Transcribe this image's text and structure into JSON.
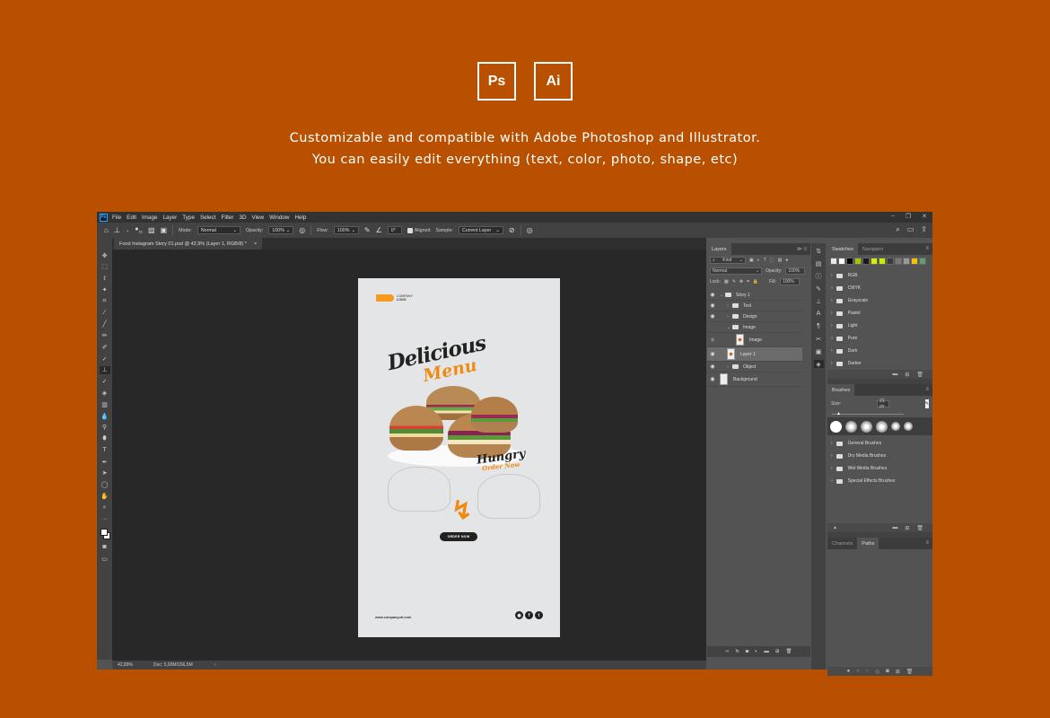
{
  "header": {
    "badges": [
      "Ps",
      "Ai"
    ],
    "tagline_line1": "Customizable and compatible with Adobe Photoshop and Illustrator.",
    "tagline_line2": "You can easily edit everything (text, color, photo, shape, etc)"
  },
  "app": {
    "logo": "Ps",
    "menu": [
      "File",
      "Edit",
      "Image",
      "Layer",
      "Type",
      "Select",
      "Filter",
      "3D",
      "View",
      "Window",
      "Help"
    ],
    "window_controls": [
      "minimize-icon",
      "restore-icon",
      "close-icon"
    ]
  },
  "options": {
    "brush_size": "21",
    "mode_label": "Mode:",
    "mode_value": "Normal",
    "opacity_label": "Opacity:",
    "opacity_value": "100%",
    "flow_label": "Flow:",
    "flow_value": "100%",
    "angle_value": "0°",
    "aligned_label": "Aligned",
    "aligned_checked": true,
    "sample_label": "Sample:",
    "sample_value": "Current Layer"
  },
  "document": {
    "tab_title": "Food Instagram Story 01.psd @ 42,9% (Layer 1, RGB/8) *",
    "tab_close": "×"
  },
  "artwork": {
    "company_line1": "COMPANY",
    "company_line2": "LOGO",
    "title": "Delicious",
    "subtitle": "Menu",
    "hungry_text": "Hungry",
    "order_script": "Order Now",
    "order_button": "ORDER NOW",
    "url": "www.companyurl.com",
    "socials": [
      "instagram-icon",
      "facebook-icon",
      "twitter-icon"
    ],
    "accent_color": "#f08a12"
  },
  "status": {
    "zoom": "42,89%",
    "doc_size": "Doc: 5,93M/156,5M"
  },
  "layers_panel": {
    "tab": "Layers",
    "kind_label": "Kind",
    "blend_mode": "Normal",
    "opacity_label": "Opacity:",
    "opacity_value": "100%",
    "lock_label": "Lock:",
    "fill_label": "Fill:",
    "fill_value": "100%",
    "layers": [
      {
        "name": "Story 1",
        "type": "group",
        "visible": true,
        "expanded": true,
        "indent": 0
      },
      {
        "name": "Text",
        "type": "group",
        "visible": true,
        "expanded": false,
        "indent": 1
      },
      {
        "name": "Design",
        "type": "group",
        "visible": true,
        "expanded": false,
        "indent": 1
      },
      {
        "name": "Image",
        "type": "group",
        "visible": false,
        "expanded": true,
        "indent": 1
      },
      {
        "name": "Image",
        "type": "layer",
        "visible": true,
        "indent": 2
      },
      {
        "name": "Layer 1",
        "type": "layer",
        "visible": true,
        "selected": true,
        "indent": 1
      },
      {
        "name": "Object",
        "type": "group",
        "visible": true,
        "expanded": false,
        "indent": 1
      },
      {
        "name": "Background",
        "type": "layer",
        "visible": true,
        "indent": 0
      }
    ]
  },
  "swatches_panel": {
    "tabs": [
      "Swatches",
      "Navigator"
    ],
    "colors": [
      "#e8e8e8",
      "#ffffff",
      "#000000",
      "#a4c400",
      "#1a1a1a",
      "#d4f000",
      "#c8ee00",
      "#3a3a3a",
      "#777777",
      "#999999",
      "#f5c000",
      "#5ea070"
    ],
    "groups": [
      "RGB",
      "CMYK",
      "Grayscale",
      "Pastel",
      "Light",
      "Pure",
      "Dark",
      "Darker"
    ]
  },
  "brushes_panel": {
    "tab": "Brushes",
    "size_label": "Size:",
    "size_value": "21 px",
    "groups": [
      "General Brushes",
      "Dry Media Brushes",
      "Wet Media Brushes",
      "Special Effects Brushes"
    ]
  },
  "paths_panel": {
    "tabs": [
      "Channels",
      "Paths"
    ]
  }
}
